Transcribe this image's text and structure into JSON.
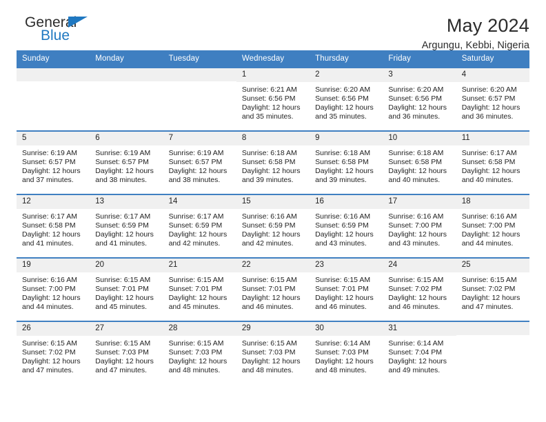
{
  "brand": {
    "word_one": "General",
    "word_two": "Blue",
    "accent_color": "#1f78c1"
  },
  "header": {
    "title": "May 2024",
    "location": "Argungu, Kebbi, Nigeria"
  },
  "theme": {
    "header_row_bg": "#3f7fc1",
    "header_row_text": "#ffffff",
    "daynum_bg": "#f0f0f0",
    "row_border": "#3f7fc1"
  },
  "calendar": {
    "weekday_headers": [
      "Sunday",
      "Monday",
      "Tuesday",
      "Wednesday",
      "Thursday",
      "Friday",
      "Saturday"
    ],
    "weeks": [
      [
        {
          "day": "",
          "sunrise": "",
          "sunset": "",
          "daylight_line1": "",
          "daylight_line2": ""
        },
        {
          "day": "",
          "sunrise": "",
          "sunset": "",
          "daylight_line1": "",
          "daylight_line2": ""
        },
        {
          "day": "",
          "sunrise": "",
          "sunset": "",
          "daylight_line1": "",
          "daylight_line2": ""
        },
        {
          "day": "1",
          "sunrise": "Sunrise: 6:21 AM",
          "sunset": "Sunset: 6:56 PM",
          "daylight_line1": "Daylight: 12 hours",
          "daylight_line2": "and 35 minutes."
        },
        {
          "day": "2",
          "sunrise": "Sunrise: 6:20 AM",
          "sunset": "Sunset: 6:56 PM",
          "daylight_line1": "Daylight: 12 hours",
          "daylight_line2": "and 35 minutes."
        },
        {
          "day": "3",
          "sunrise": "Sunrise: 6:20 AM",
          "sunset": "Sunset: 6:56 PM",
          "daylight_line1": "Daylight: 12 hours",
          "daylight_line2": "and 36 minutes."
        },
        {
          "day": "4",
          "sunrise": "Sunrise: 6:20 AM",
          "sunset": "Sunset: 6:57 PM",
          "daylight_line1": "Daylight: 12 hours",
          "daylight_line2": "and 36 minutes."
        }
      ],
      [
        {
          "day": "5",
          "sunrise": "Sunrise: 6:19 AM",
          "sunset": "Sunset: 6:57 PM",
          "daylight_line1": "Daylight: 12 hours",
          "daylight_line2": "and 37 minutes."
        },
        {
          "day": "6",
          "sunrise": "Sunrise: 6:19 AM",
          "sunset": "Sunset: 6:57 PM",
          "daylight_line1": "Daylight: 12 hours",
          "daylight_line2": "and 38 minutes."
        },
        {
          "day": "7",
          "sunrise": "Sunrise: 6:19 AM",
          "sunset": "Sunset: 6:57 PM",
          "daylight_line1": "Daylight: 12 hours",
          "daylight_line2": "and 38 minutes."
        },
        {
          "day": "8",
          "sunrise": "Sunrise: 6:18 AM",
          "sunset": "Sunset: 6:58 PM",
          "daylight_line1": "Daylight: 12 hours",
          "daylight_line2": "and 39 minutes."
        },
        {
          "day": "9",
          "sunrise": "Sunrise: 6:18 AM",
          "sunset": "Sunset: 6:58 PM",
          "daylight_line1": "Daylight: 12 hours",
          "daylight_line2": "and 39 minutes."
        },
        {
          "day": "10",
          "sunrise": "Sunrise: 6:18 AM",
          "sunset": "Sunset: 6:58 PM",
          "daylight_line1": "Daylight: 12 hours",
          "daylight_line2": "and 40 minutes."
        },
        {
          "day": "11",
          "sunrise": "Sunrise: 6:17 AM",
          "sunset": "Sunset: 6:58 PM",
          "daylight_line1": "Daylight: 12 hours",
          "daylight_line2": "and 40 minutes."
        }
      ],
      [
        {
          "day": "12",
          "sunrise": "Sunrise: 6:17 AM",
          "sunset": "Sunset: 6:58 PM",
          "daylight_line1": "Daylight: 12 hours",
          "daylight_line2": "and 41 minutes."
        },
        {
          "day": "13",
          "sunrise": "Sunrise: 6:17 AM",
          "sunset": "Sunset: 6:59 PM",
          "daylight_line1": "Daylight: 12 hours",
          "daylight_line2": "and 41 minutes."
        },
        {
          "day": "14",
          "sunrise": "Sunrise: 6:17 AM",
          "sunset": "Sunset: 6:59 PM",
          "daylight_line1": "Daylight: 12 hours",
          "daylight_line2": "and 42 minutes."
        },
        {
          "day": "15",
          "sunrise": "Sunrise: 6:16 AM",
          "sunset": "Sunset: 6:59 PM",
          "daylight_line1": "Daylight: 12 hours",
          "daylight_line2": "and 42 minutes."
        },
        {
          "day": "16",
          "sunrise": "Sunrise: 6:16 AM",
          "sunset": "Sunset: 6:59 PM",
          "daylight_line1": "Daylight: 12 hours",
          "daylight_line2": "and 43 minutes."
        },
        {
          "day": "17",
          "sunrise": "Sunrise: 6:16 AM",
          "sunset": "Sunset: 7:00 PM",
          "daylight_line1": "Daylight: 12 hours",
          "daylight_line2": "and 43 minutes."
        },
        {
          "day": "18",
          "sunrise": "Sunrise: 6:16 AM",
          "sunset": "Sunset: 7:00 PM",
          "daylight_line1": "Daylight: 12 hours",
          "daylight_line2": "and 44 minutes."
        }
      ],
      [
        {
          "day": "19",
          "sunrise": "Sunrise: 6:16 AM",
          "sunset": "Sunset: 7:00 PM",
          "daylight_line1": "Daylight: 12 hours",
          "daylight_line2": "and 44 minutes."
        },
        {
          "day": "20",
          "sunrise": "Sunrise: 6:15 AM",
          "sunset": "Sunset: 7:01 PM",
          "daylight_line1": "Daylight: 12 hours",
          "daylight_line2": "and 45 minutes."
        },
        {
          "day": "21",
          "sunrise": "Sunrise: 6:15 AM",
          "sunset": "Sunset: 7:01 PM",
          "daylight_line1": "Daylight: 12 hours",
          "daylight_line2": "and 45 minutes."
        },
        {
          "day": "22",
          "sunrise": "Sunrise: 6:15 AM",
          "sunset": "Sunset: 7:01 PM",
          "daylight_line1": "Daylight: 12 hours",
          "daylight_line2": "and 46 minutes."
        },
        {
          "day": "23",
          "sunrise": "Sunrise: 6:15 AM",
          "sunset": "Sunset: 7:01 PM",
          "daylight_line1": "Daylight: 12 hours",
          "daylight_line2": "and 46 minutes."
        },
        {
          "day": "24",
          "sunrise": "Sunrise: 6:15 AM",
          "sunset": "Sunset: 7:02 PM",
          "daylight_line1": "Daylight: 12 hours",
          "daylight_line2": "and 46 minutes."
        },
        {
          "day": "25",
          "sunrise": "Sunrise: 6:15 AM",
          "sunset": "Sunset: 7:02 PM",
          "daylight_line1": "Daylight: 12 hours",
          "daylight_line2": "and 47 minutes."
        }
      ],
      [
        {
          "day": "26",
          "sunrise": "Sunrise: 6:15 AM",
          "sunset": "Sunset: 7:02 PM",
          "daylight_line1": "Daylight: 12 hours",
          "daylight_line2": "and 47 minutes."
        },
        {
          "day": "27",
          "sunrise": "Sunrise: 6:15 AM",
          "sunset": "Sunset: 7:03 PM",
          "daylight_line1": "Daylight: 12 hours",
          "daylight_line2": "and 47 minutes."
        },
        {
          "day": "28",
          "sunrise": "Sunrise: 6:15 AM",
          "sunset": "Sunset: 7:03 PM",
          "daylight_line1": "Daylight: 12 hours",
          "daylight_line2": "and 48 minutes."
        },
        {
          "day": "29",
          "sunrise": "Sunrise: 6:15 AM",
          "sunset": "Sunset: 7:03 PM",
          "daylight_line1": "Daylight: 12 hours",
          "daylight_line2": "and 48 minutes."
        },
        {
          "day": "30",
          "sunrise": "Sunrise: 6:14 AM",
          "sunset": "Sunset: 7:03 PM",
          "daylight_line1": "Daylight: 12 hours",
          "daylight_line2": "and 48 minutes."
        },
        {
          "day": "31",
          "sunrise": "Sunrise: 6:14 AM",
          "sunset": "Sunset: 7:04 PM",
          "daylight_line1": "Daylight: 12 hours",
          "daylight_line2": "and 49 minutes."
        },
        {
          "day": "",
          "sunrise": "",
          "sunset": "",
          "daylight_line1": "",
          "daylight_line2": ""
        }
      ]
    ]
  }
}
